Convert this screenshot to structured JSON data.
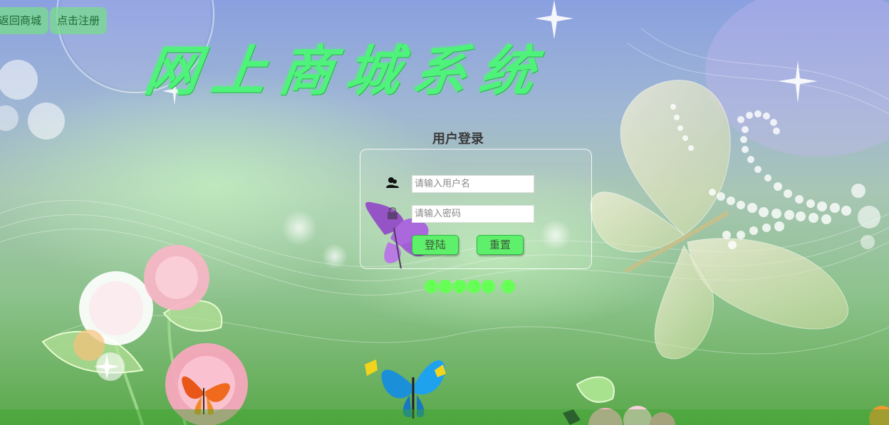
{
  "top_nav": {
    "back_label": "返回商城",
    "register_label": "点击注册"
  },
  "site_title": "网上商城系统",
  "login": {
    "heading": "用户登录",
    "username_placeholder": "请输入用户名",
    "username_value": "",
    "password_placeholder": "请输入密码",
    "password_value": "",
    "login_label": "登陆",
    "reset_label": "重置"
  },
  "icons": {
    "username": "user-icon",
    "password": "lock-icon"
  },
  "colors": {
    "accent_green": "#5ff06b",
    "title_green": "#4ff27a",
    "dot_green": "#66ff55"
  },
  "indicator_dots": 6
}
